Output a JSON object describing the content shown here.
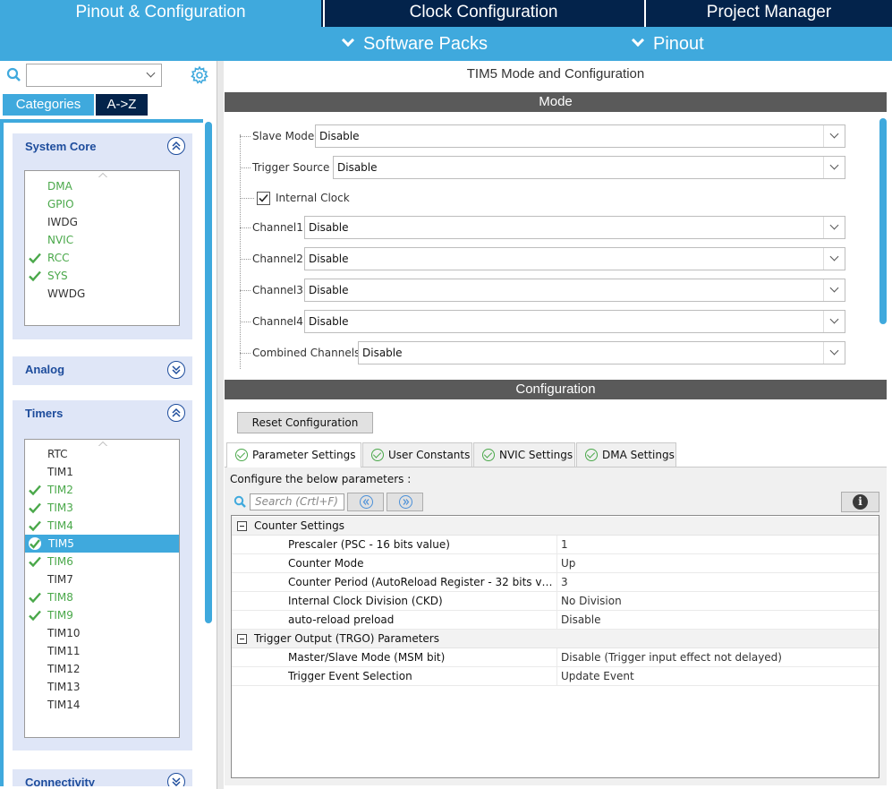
{
  "top_tabs": [
    "Pinout & Configuration",
    "Clock Configuration",
    "Project Manager"
  ],
  "sub_menu": [
    "Software Packs",
    "Pinout"
  ],
  "left": {
    "categories_label": "Categories",
    "az_label": "A->Z",
    "groups": {
      "system_core": {
        "title": "System Core",
        "items": [
          {
            "label": "DMA",
            "status": "green"
          },
          {
            "label": "GPIO",
            "status": "green"
          },
          {
            "label": "IWDG",
            "status": "plain"
          },
          {
            "label": "NVIC",
            "status": "green"
          },
          {
            "label": "RCC",
            "status": "checked"
          },
          {
            "label": "SYS",
            "status": "checked"
          },
          {
            "label": "WWDG",
            "status": "plain"
          }
        ]
      },
      "analog": {
        "title": "Analog"
      },
      "timers": {
        "title": "Timers",
        "selected": "TIM5",
        "items": [
          {
            "label": "RTC",
            "status": "plain"
          },
          {
            "label": "TIM1",
            "status": "plain"
          },
          {
            "label": "TIM2",
            "status": "checked"
          },
          {
            "label": "TIM3",
            "status": "checked"
          },
          {
            "label": "TIM4",
            "status": "checked"
          },
          {
            "label": "TIM5",
            "status": "selected"
          },
          {
            "label": "TIM6",
            "status": "checked"
          },
          {
            "label": "TIM7",
            "status": "plain"
          },
          {
            "label": "TIM8",
            "status": "checked"
          },
          {
            "label": "TIM9",
            "status": "checked"
          },
          {
            "label": "TIM10",
            "status": "plain"
          },
          {
            "label": "TIM11",
            "status": "plain"
          },
          {
            "label": "TIM12",
            "status": "plain"
          },
          {
            "label": "TIM13",
            "status": "plain"
          },
          {
            "label": "TIM14",
            "status": "plain"
          }
        ]
      },
      "connectivity": {
        "title": "Connectivity"
      }
    }
  },
  "main": {
    "title": "TIM5 Mode and Configuration",
    "mode_header": "Mode",
    "mode": {
      "slave_mode": {
        "label": "Slave Mode",
        "value": "Disable"
      },
      "trigger_source": {
        "label": "Trigger Source",
        "value": "Disable"
      },
      "internal_clock": {
        "label": "Internal Clock",
        "checked": true
      },
      "channel1": {
        "label": "Channel1",
        "value": "Disable"
      },
      "channel2": {
        "label": "Channel2",
        "value": "Disable"
      },
      "channel3": {
        "label": "Channel3",
        "value": "Disable"
      },
      "channel4": {
        "label": "Channel4",
        "value": "Disable"
      },
      "combined_channels": {
        "label": "Combined Channels",
        "value": "Disable"
      }
    },
    "config_header": "Configuration",
    "reset_button": "Reset Configuration",
    "tabs": [
      "Parameter Settings",
      "User Constants",
      "NVIC Settings",
      "DMA Settings"
    ],
    "active_tab": "Parameter Settings",
    "caption": "Configure the below parameters :",
    "search_placeholder": "Search (Crtl+F)",
    "groups": [
      {
        "title": "Counter Settings",
        "rows": [
          {
            "name": "Prescaler (PSC - 16 bits value)",
            "value": "1"
          },
          {
            "name": "Counter Mode",
            "value": "Up"
          },
          {
            "name": "Counter Period (AutoReload Register - 32 bits val...",
            "value": "3"
          },
          {
            "name": "Internal Clock Division (CKD)",
            "value": "No Division"
          },
          {
            "name": "auto-reload preload",
            "value": "Disable"
          }
        ]
      },
      {
        "title": "Trigger Output (TRGO) Parameters",
        "rows": [
          {
            "name": "Master/Slave Mode (MSM bit)",
            "value": "Disable (Trigger input effect not delayed)"
          },
          {
            "name": "Trigger Event Selection",
            "value": "Update Event"
          }
        ]
      }
    ]
  },
  "colors": {
    "accent": "#3fa9dd",
    "navy": "#03234b",
    "green": "#4aa84a",
    "group_title": "#1d4c9c"
  }
}
